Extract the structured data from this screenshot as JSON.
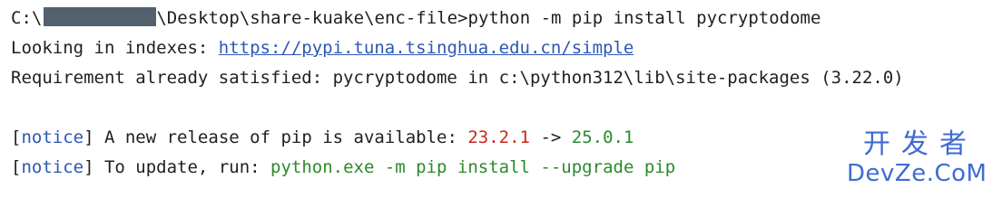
{
  "terminal": {
    "line1": {
      "prompt_start": "C:\\",
      "prompt_path": "\\Desktop\\share-kuake\\enc-file>",
      "command": "python -m pip install pycryptodome"
    },
    "line2": {
      "label": "Looking in indexes: ",
      "url": "https://pypi.tuna.tsinghua.edu.cn/simple"
    },
    "line3": {
      "text": "Requirement already satisfied: pycryptodome in c:\\python312\\lib\\site-packages (3.22.0)"
    },
    "line4": {
      "bracket_open": "[",
      "notice": "notice",
      "bracket_close": "]",
      "text": " A new release of pip is available: ",
      "old_version": "23.2.1",
      "arrow": " -> ",
      "new_version": "25.0.1"
    },
    "line5": {
      "bracket_open": "[",
      "notice": "notice",
      "bracket_close": "]",
      "text": " To update, run: ",
      "command": "python.exe -m pip install --upgrade pip"
    }
  },
  "watermark": {
    "chinese": "开发者",
    "english": "DevZe.CoM"
  },
  "colors": {
    "link": "#2d57b3",
    "old_version": "#c8281e",
    "new_version": "#2b8a2b",
    "watermark": "#2f5fd0"
  }
}
